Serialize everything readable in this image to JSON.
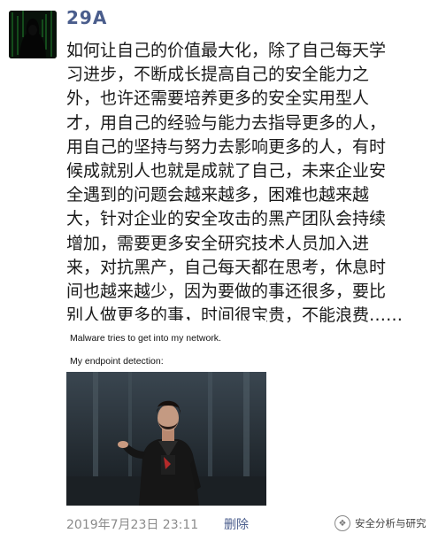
{
  "author": {
    "name": "29A"
  },
  "post": {
    "lines": [
      "如何让自己的价值最大化，除了自己每天学",
      "习进步，不断成长提高自己的安全能力之",
      "外，也许还需要培养更多的安全实用型人",
      "才，用自己的经验与能力去指导更多的人，",
      "用自己的坚持与努力去影响更多的人，有时",
      "候成就别人也就是成就了自己，未来企业安",
      "全遇到的问题会越来越多，困难也越来越",
      "大，针对企业的安全攻击的黑产团队会持续",
      "增加，需要更多安全研究技术人员加入进",
      "来，对抗黑产，自己每天都在思考，休息时",
      "间也越来越少，因为要做的事还很多，要比",
      "别人做更多的事，时间很宝贵，不能浪费……"
    ]
  },
  "meme": {
    "caption_top": "Malware tries to get into my network.",
    "caption_bottom": "My endpoint detection:"
  },
  "footer": {
    "timestamp": "2019年7月23日 23:11",
    "delete_label": "删除"
  },
  "watermark": {
    "icon": "wechat-channel-icon",
    "text": "安全分析与研究"
  },
  "colors": {
    "author_name": "#4a5d8c",
    "delete_link": "#4a5d8c",
    "timestamp": "#8b8b8b"
  }
}
